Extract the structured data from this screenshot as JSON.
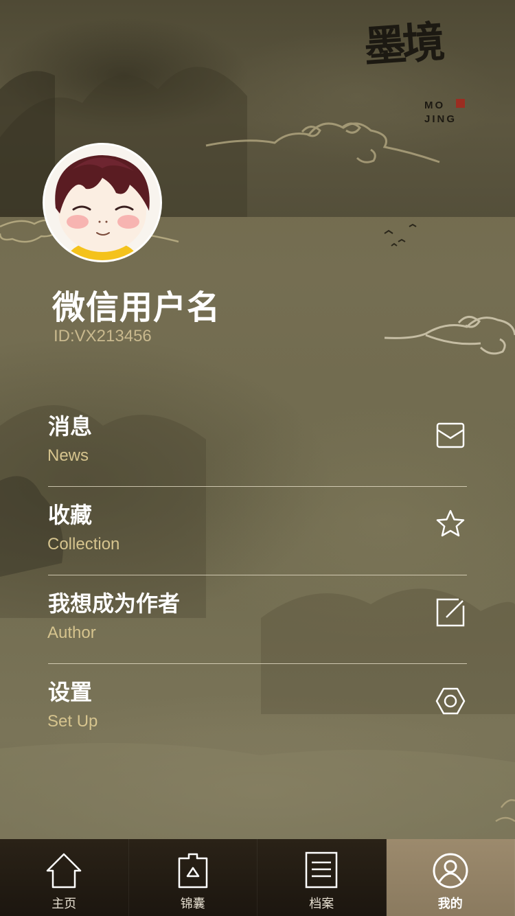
{
  "logo": {
    "callig_text": "墨境",
    "latin_line1": "MO",
    "latin_line2": "JING"
  },
  "profile": {
    "username": "微信用户名",
    "user_id": "ID:VX213456"
  },
  "menu": {
    "items": [
      {
        "title": "消息",
        "subtitle": "News",
        "icon": "envelope-icon"
      },
      {
        "title": "收藏",
        "subtitle": "Collection",
        "icon": "star-icon"
      },
      {
        "title": "我想成为作者",
        "subtitle": "Author",
        "icon": "edit-icon"
      },
      {
        "title": "设置",
        "subtitle": "Set Up",
        "icon": "settings-icon"
      }
    ]
  },
  "tabbar": {
    "tabs": [
      {
        "label": "主页",
        "icon": "home-icon",
        "active": false
      },
      {
        "label": "锦囊",
        "icon": "bag-icon",
        "active": false
      },
      {
        "label": "档案",
        "icon": "document-icon",
        "active": false
      },
      {
        "label": "我的",
        "icon": "user-icon",
        "active": true
      }
    ]
  },
  "colors": {
    "background": "#6f6a4e",
    "header_band": "#565039",
    "subtitle_gold": "#d6c48e",
    "tabbar": "#1f1811",
    "tab_active": "#9c8a6d"
  }
}
